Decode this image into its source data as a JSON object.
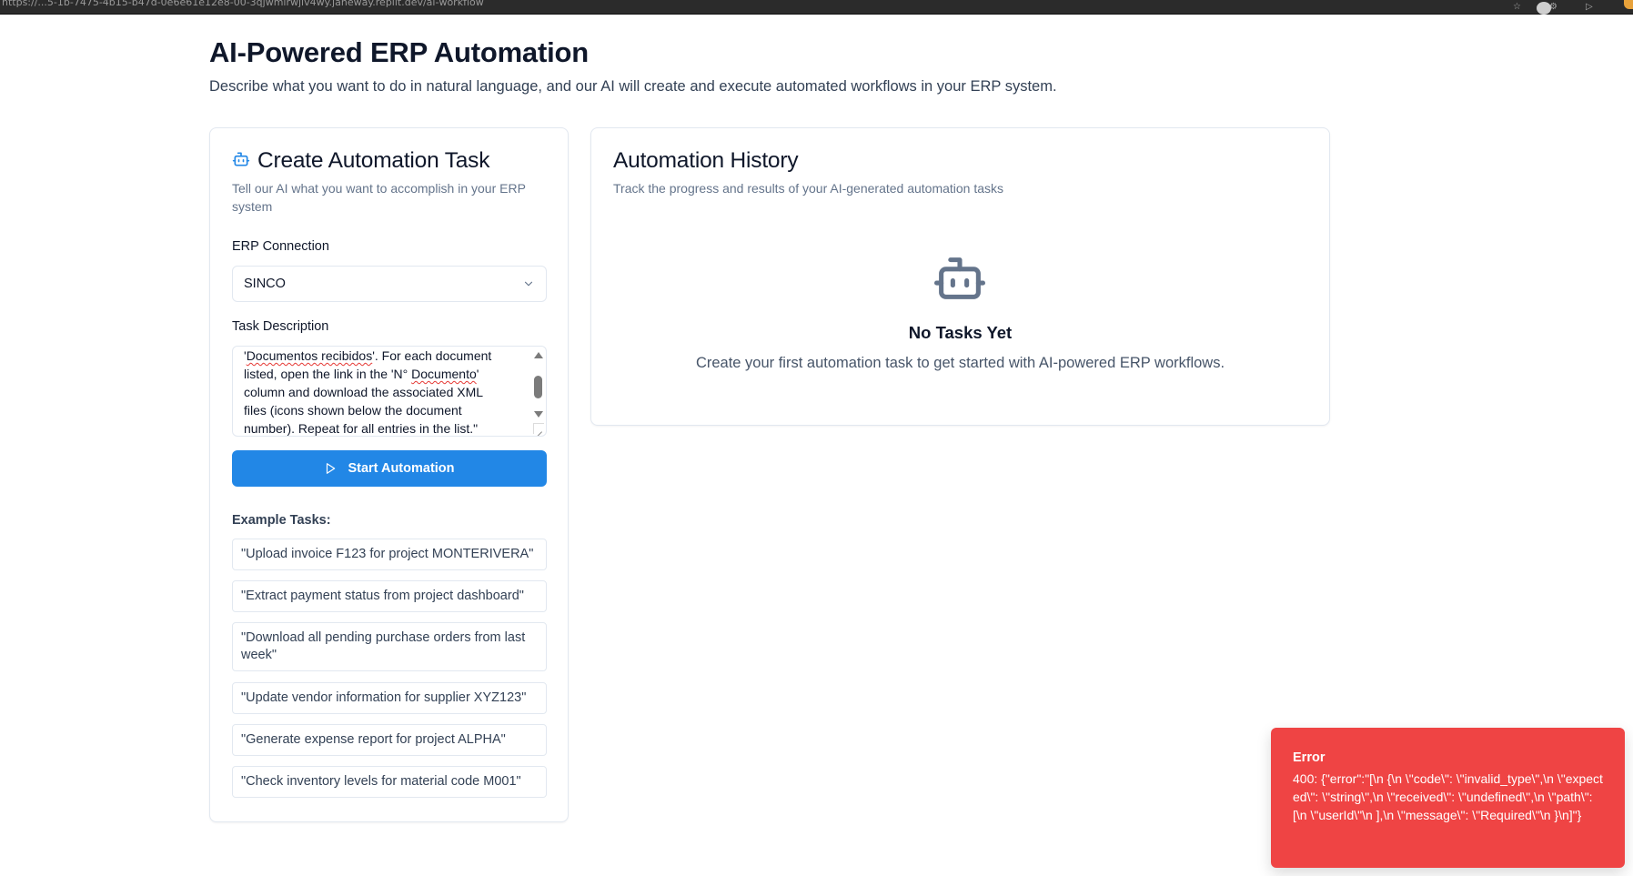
{
  "browser": {
    "url": "https://...5-1b-7475-4b15-b47d-0e6e61e12e8-00-3qjwmirwjlv4wy.janeway.replit.dev/ai-workflow"
  },
  "header": {
    "title": "AI-Powered ERP Automation",
    "subtitle": "Describe what you want to do in natural language, and our AI will create and execute automated workflows in your ERP system."
  },
  "create_task": {
    "icon": "bot-icon",
    "title": "Create Automation Task",
    "description": "Tell our AI what you want to accomplish in your ERP system",
    "erp_label": "ERP Connection",
    "erp_selected": "SINCO",
    "task_label": "Task Description",
    "task_text": {
      "line1_prefix": "'",
      "line1_misspelled": "Documentos recibidos",
      "line1_suffix": "'. For each document",
      "line2_prefix": "listed, open the link in the 'N° ",
      "line2_misspelled": "Documento",
      "line2_suffix": "'",
      "line3": "column and download the associated XML",
      "line4": "files (icons shown below the document",
      "line5": "number). Repeat for all entries in the list.\""
    },
    "start_button": "Start Automation",
    "examples_label": "Example Tasks:",
    "examples": [
      "\"Upload invoice F123 for project MONTERIVERA\"",
      "\"Extract payment status from project dashboard\"",
      "\"Download all pending purchase orders from last week\"",
      "\"Update vendor information for supplier XYZ123\"",
      "\"Generate expense report for project ALPHA\"",
      "\"Check inventory levels for material code M001\""
    ]
  },
  "history": {
    "title": "Automation History",
    "description": "Track the progress and results of your AI-generated automation tasks",
    "empty_icon": "bot-icon",
    "empty_title": "No Tasks Yet",
    "empty_description": "Create your first automation task to get started with AI-powered ERP workflows."
  },
  "toast": {
    "title": "Error",
    "message": "400: {\"error\":\"[\\n {\\n \\\"code\\\": \\\"invalid_type\\\",\\n \\\"expected\\\": \\\"string\\\",\\n \\\"received\\\": \\\"undefined\\\",\\n \\\"path\\\": [\\n \\\"userId\\\"\\n ],\\n \\\"message\\\": \\\"Required\\\"\\n }\\n]\"}"
  },
  "colors": {
    "primary": "#2287e6",
    "error": "#ef4444",
    "icon_blue": "#2287e6",
    "empty_icon_gray": "#64748b"
  }
}
